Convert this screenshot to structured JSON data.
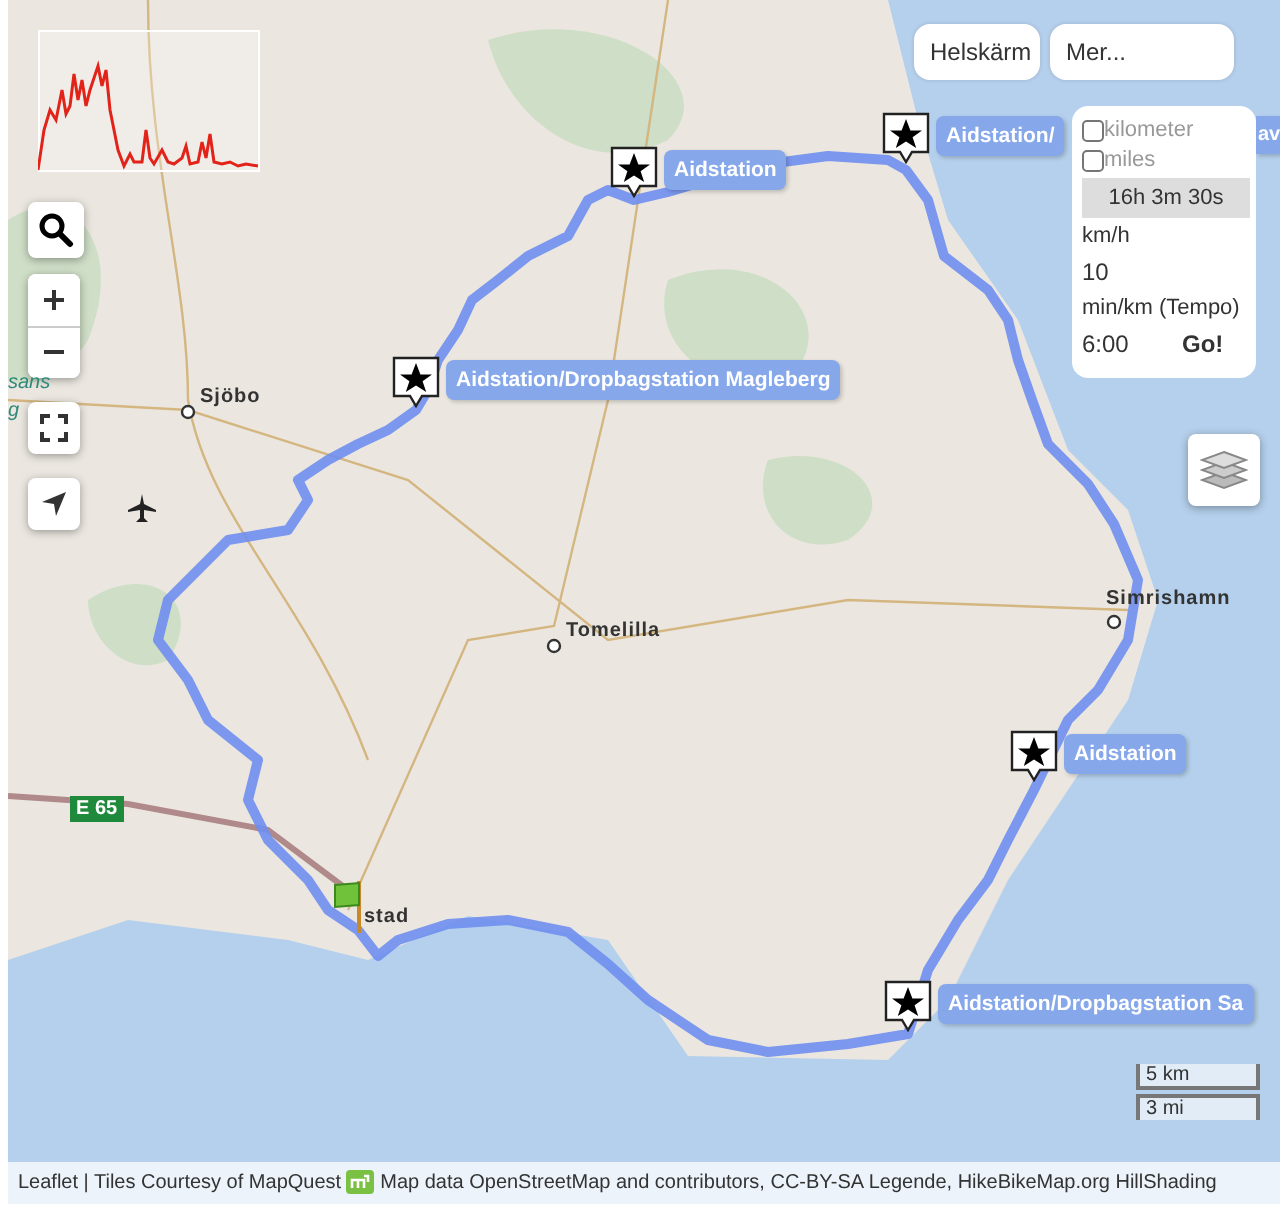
{
  "top_buttons": [
    "Helskärm",
    "Mer..."
  ],
  "pace_panel": {
    "units": [
      {
        "label": "kilometer",
        "checked": false
      },
      {
        "label": "miles",
        "checked": false
      }
    ],
    "duration": "16h 3m 30s",
    "speed": {
      "label": "km/h",
      "value": "10"
    },
    "pace": {
      "label": "min/km (Tempo)",
      "value": "6:00"
    },
    "go": "Go!"
  },
  "markers": [
    {
      "label": "Aidstation"
    },
    {
      "label": "Aidstation/"
    },
    {
      "label": "Aidstation/Dropbagstation Magleberg"
    },
    {
      "label": "Aidstation"
    },
    {
      "label": "Aidstation/Dropbagstation Sa"
    }
  ],
  "label_fragment": "av",
  "places": [
    "Sjöbo",
    "Tomelilla",
    "Simrishamn",
    "stad"
  ],
  "edge_labels": [
    "sans",
    "g"
  ],
  "road_badge": "E 65",
  "scale": [
    "5 km",
    "3 mi"
  ],
  "attribution": {
    "tiles": "Leaflet | Tiles Courtesy of MapQuest",
    "map_data": "Map data OpenStreetMap and contributors, CC-BY-SA Legende, HikeBikeMap.org HillShading"
  }
}
